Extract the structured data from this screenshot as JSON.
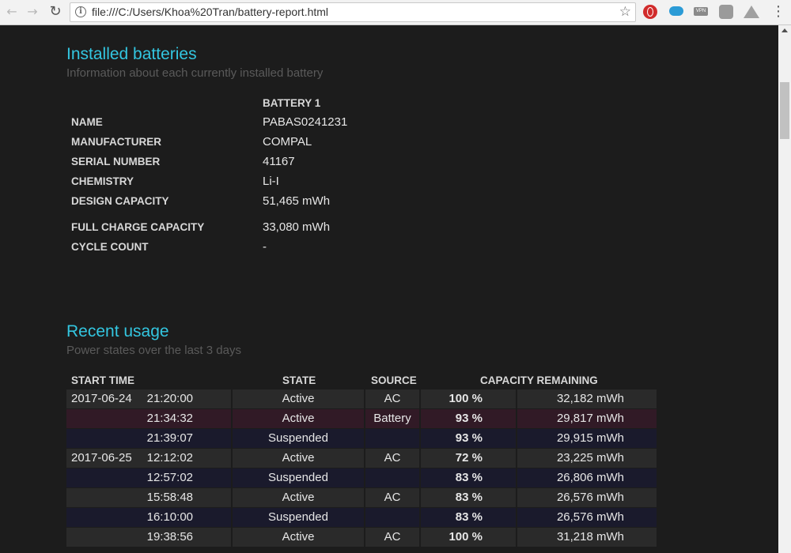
{
  "browser": {
    "url": "file:///C:/Users/Khoa%20Tran/battery-report.html",
    "info_icon": "info-icon",
    "vpn_label": "VPN"
  },
  "installed": {
    "title": "Installed batteries",
    "subtitle": "Information about each currently installed battery",
    "column_header": "BATTERY 1",
    "rows": [
      {
        "label": "NAME",
        "value": "PABAS0241231"
      },
      {
        "label": "MANUFACTURER",
        "value": "COMPAL"
      },
      {
        "label": "SERIAL NUMBER",
        "value": "41167"
      },
      {
        "label": "CHEMISTRY",
        "value": "Li-I"
      },
      {
        "label": "DESIGN CAPACITY",
        "value": "51,465 mWh"
      },
      {
        "label": "FULL CHARGE CAPACITY",
        "value": "33,080 mWh"
      },
      {
        "label": "CYCLE COUNT",
        "value": "-"
      }
    ]
  },
  "usage": {
    "title": "Recent usage",
    "subtitle": "Power states over the last 3 days",
    "headers": {
      "start_time": "START TIME",
      "state": "STATE",
      "source": "SOURCE",
      "capacity": "CAPACITY REMAINING"
    },
    "rows": [
      {
        "date": "2017-06-24",
        "time": "21:20:00",
        "state": "Active",
        "source": "AC",
        "percent": "100 %",
        "mwh": "32,182 mWh"
      },
      {
        "date": "",
        "time": "21:34:32",
        "state": "Active",
        "source": "Battery",
        "percent": "93 %",
        "mwh": "29,817 mWh"
      },
      {
        "date": "",
        "time": "21:39:07",
        "state": "Suspended",
        "source": "",
        "percent": "93 %",
        "mwh": "29,915 mWh"
      },
      {
        "date": "2017-06-25",
        "time": "12:12:02",
        "state": "Active",
        "source": "AC",
        "percent": "72 %",
        "mwh": "23,225 mWh"
      },
      {
        "date": "",
        "time": "12:57:02",
        "state": "Suspended",
        "source": "",
        "percent": "83 %",
        "mwh": "26,806 mWh"
      },
      {
        "date": "",
        "time": "15:58:48",
        "state": "Active",
        "source": "AC",
        "percent": "83 %",
        "mwh": "26,576 mWh"
      },
      {
        "date": "",
        "time": "16:10:00",
        "state": "Suspended",
        "source": "",
        "percent": "83 %",
        "mwh": "26,576 mWh"
      },
      {
        "date": "",
        "time": "19:38:56",
        "state": "Active",
        "source": "AC",
        "percent": "100 %",
        "mwh": "31,218 mWh"
      }
    ]
  },
  "colors": {
    "heading": "#33c6e0",
    "background": "#1c1c1c",
    "row_active": "#2a2a2a",
    "row_suspended": "#1a1a2c",
    "row_battery": "#311a26"
  }
}
